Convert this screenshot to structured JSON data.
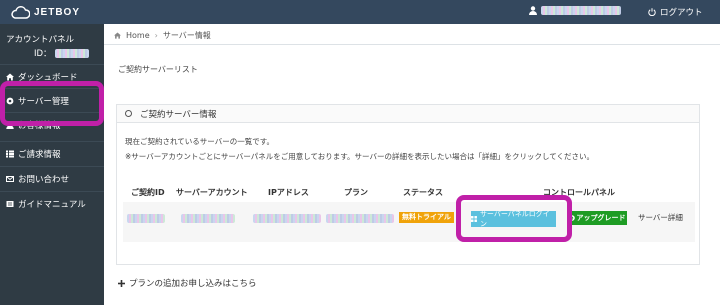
{
  "header": {
    "logo_text": "JETBOY",
    "logout_label": "ログアウト"
  },
  "sidebar": {
    "account_title": "アカウントパネル",
    "id_label": "ID：",
    "items": [
      {
        "label": "ダッシュボード",
        "icon": "home-icon"
      },
      {
        "label": "サーバー管理",
        "icon": "server-icon"
      },
      {
        "label": "お客様情報",
        "icon": "user-info-icon"
      },
      {
        "label": "ご請求情報",
        "icon": "list-icon"
      },
      {
        "label": "お問い合わせ",
        "icon": "envelope-icon"
      },
      {
        "label": "ガイドマニュアル",
        "icon": "book-icon"
      }
    ]
  },
  "breadcrumb": {
    "home": "Home",
    "separator": "›",
    "current": "サーバー情報"
  },
  "main": {
    "section_title": "ご契約サーバーリスト",
    "box_title": "ご契約サーバー情報",
    "desc1": "現在ご契約されているサーバーの一覧です。",
    "desc2": "※サーバーアカウントごとにサーバーパネルをご用意しております。サーバーの詳細を表示したい場合は「詳細」をクリックしてください。",
    "columns": [
      "ご契約ID",
      "サーバーアカウント",
      "IPアドレス",
      "プラン",
      "ステータス",
      "コントロールパネル"
    ],
    "row": {
      "status": "無料トライアル",
      "panel_button": "サーバーパネルログイン",
      "upgrade_button": "アップグレード",
      "detail_link": "サーバー詳細"
    },
    "add_plan_link": "プランの追加お申し込みはこちら"
  },
  "colors": {
    "topbar": "#34485e",
    "sidebar": "#2f3b44",
    "highlight": "#c020a8",
    "panel_button": "#5bc0de",
    "upgrade_button": "#1e9c24",
    "trial_badge": "#f0a30a"
  }
}
